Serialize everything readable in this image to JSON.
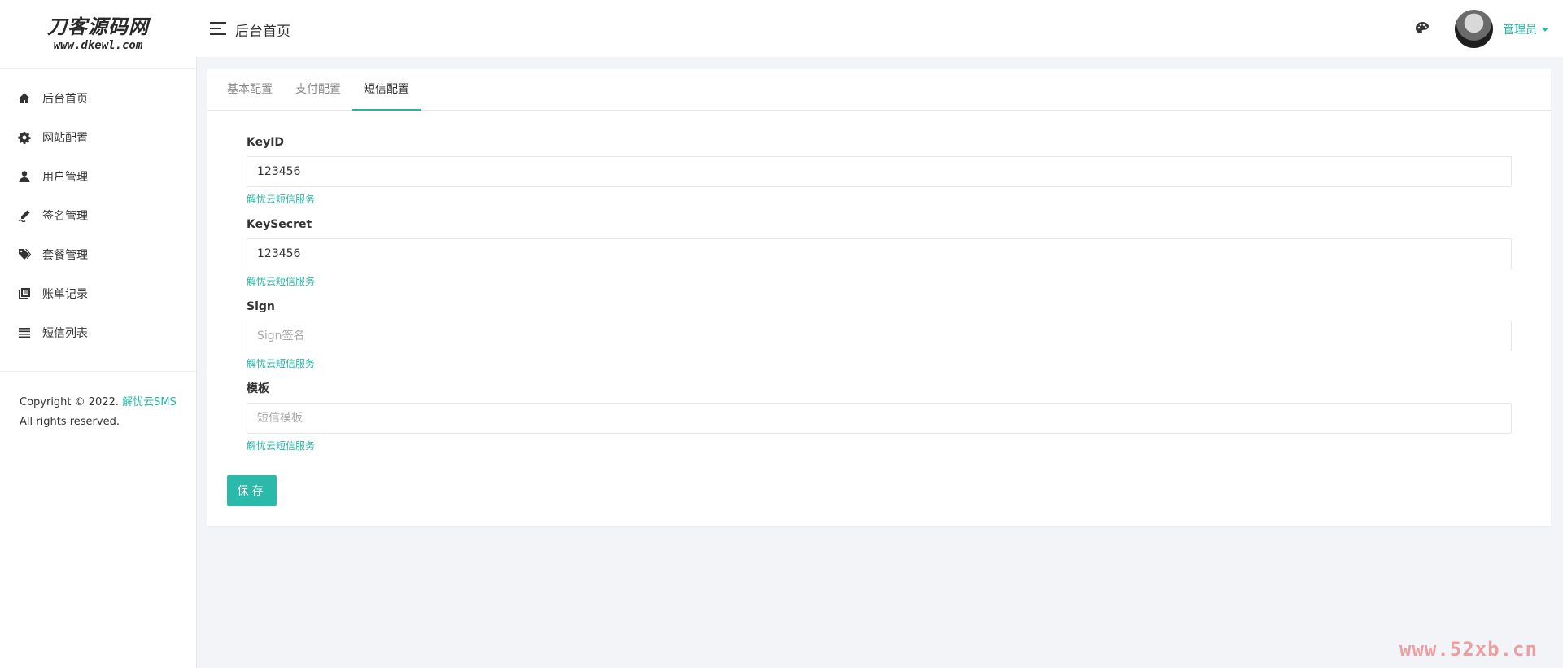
{
  "brand": {
    "logo_main": "刀客源码网",
    "logo_sub": "www.dkewl.com"
  },
  "sidebar": {
    "items": [
      {
        "label": "后台首页",
        "icon": "home-icon"
      },
      {
        "label": "网站配置",
        "icon": "gear-icon"
      },
      {
        "label": "用户管理",
        "icon": "user-icon"
      },
      {
        "label": "签名管理",
        "icon": "signature-icon"
      },
      {
        "label": "套餐管理",
        "icon": "tags-icon"
      },
      {
        "label": "账单记录",
        "icon": "book-icon"
      },
      {
        "label": "短信列表",
        "icon": "list-icon"
      }
    ],
    "footer_prefix": "Copyright © 2022.",
    "footer_brand": "解忧云SMS",
    "footer_rights": "All rights reserved."
  },
  "header": {
    "title": "后台首页",
    "user_label": "管理员"
  },
  "tabs": [
    {
      "label": "基本配置",
      "active": false
    },
    {
      "label": "支付配置",
      "active": false
    },
    {
      "label": "短信配置",
      "active": true
    }
  ],
  "form": {
    "fields": [
      {
        "label": "KeyID",
        "value": "123456",
        "placeholder": "",
        "help": "解忧云短信服务"
      },
      {
        "label": "KeySecret",
        "value": "123456",
        "placeholder": "",
        "help": "解忧云短信服务"
      },
      {
        "label": "Sign",
        "value": "",
        "placeholder": "Sign签名",
        "help": "解忧云短信服务"
      },
      {
        "label": "模板",
        "value": "",
        "placeholder": "短信模板",
        "help": "解忧云短信服务"
      }
    ],
    "save_label": "保存"
  },
  "watermark": "www.52xb.cn",
  "colors": {
    "accent": "#26b5a4",
    "button": "#2bbaa9",
    "background": "#f3f4f8"
  }
}
